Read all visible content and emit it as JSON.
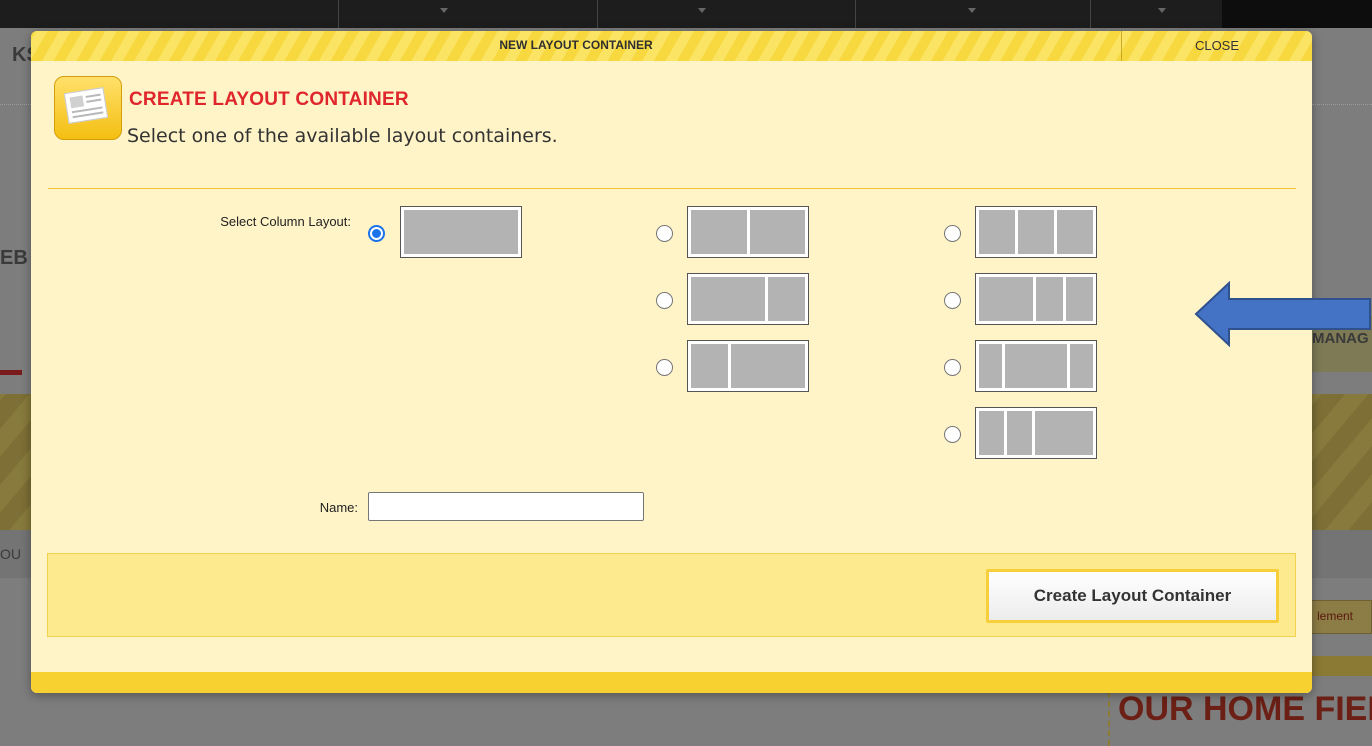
{
  "modal": {
    "title": "NEW LAYOUT CONTAINER",
    "close_label": "CLOSE",
    "header_title": "CREATE LAYOUT CONTAINER",
    "header_subtitle": "Select one of the available layout containers.",
    "select_label": "Select Column Layout:",
    "name_label": "Name:",
    "name_value": "",
    "submit_label": "Create Layout Container",
    "layout_options": [
      {
        "name": "1 column",
        "columns": [
          1
        ],
        "selected": true
      },
      {
        "name": "2 columns equal",
        "columns": [
          1,
          1
        ],
        "selected": false
      },
      {
        "name": "2 columns wide-narrow",
        "columns": [
          2,
          1
        ],
        "selected": false
      },
      {
        "name": "2 columns narrow-wide",
        "columns": [
          1,
          2
        ],
        "selected": false
      },
      {
        "name": "3 columns equal",
        "columns": [
          1,
          1,
          1
        ],
        "selected": false
      },
      {
        "name": "3 columns wide-narrow-narrow",
        "columns": [
          2,
          1,
          1
        ],
        "selected": false
      },
      {
        "name": "3 columns narrow-wide-narrow",
        "columns": [
          1,
          2,
          1
        ],
        "selected": false
      },
      {
        "name": "3 columns narrow-narrow-wide",
        "columns": [
          1,
          1,
          2
        ],
        "selected": false
      }
    ]
  },
  "background_page": {
    "partial_text_left_1": "KS",
    "partial_text_left_2": "EB",
    "partial_text_left_3": "OU",
    "partial_text_right": "MANAG",
    "partial_button_text": "lement",
    "partial_heading": "OUR HOME FIEI"
  },
  "colors": {
    "accent_yellow": "#f7d130",
    "title_red": "#e0262d",
    "modal_bg": "#fff4c7",
    "arrow_blue": "#4472c4",
    "radio_blue": "#1a73e8"
  },
  "icons": [
    "layout-container-icon",
    "arrow-left-annotation-icon"
  ]
}
